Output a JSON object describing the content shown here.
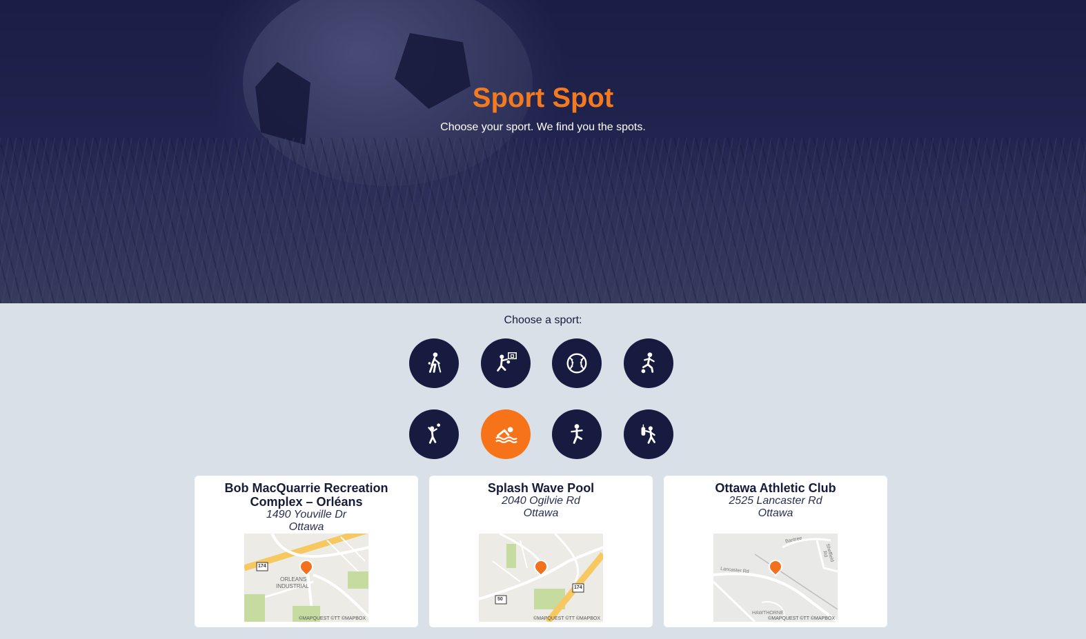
{
  "hero": {
    "title": "Sport Spot",
    "subtitle": "Choose your sport. We find you the spots."
  },
  "chooser": {
    "label": "Choose a sport:",
    "sports": [
      {
        "icon": "cricket-icon",
        "selected": false
      },
      {
        "icon": "basketball-icon",
        "selected": false
      },
      {
        "icon": "baseball-icon",
        "selected": false
      },
      {
        "icon": "soccer-icon",
        "selected": false
      },
      {
        "icon": "volleyball-icon",
        "selected": false
      },
      {
        "icon": "swimming-icon",
        "selected": true
      },
      {
        "icon": "gymnastics-icon",
        "selected": false
      },
      {
        "icon": "boxing-icon",
        "selected": false
      }
    ]
  },
  "colors": {
    "accent": "#f37a1f",
    "navy": "#181b40",
    "page_bg": "#d9e0e8"
  },
  "results": [
    {
      "name": "Bob MacQuarrie Recreation Complex – Orléans",
      "street": "1490 Youville Dr",
      "city": "Ottawa",
      "map": {
        "road_badge": "174",
        "area_label_1": "ORLEANS",
        "area_label_2": "INDUSTRIAL",
        "credit": "©MAPQUEST ©TT ©MAPBOX"
      }
    },
    {
      "name": "Splash Wave Pool",
      "street": "2040 Ogilvie Rd",
      "city": "Ottawa",
      "map": {
        "road_badge": "174",
        "road_badge_2": "50",
        "credit": "©MAPQUEST ©TT ©MAPBOX"
      }
    },
    {
      "name": "Ottawa Athletic Club",
      "street": "2525 Lancaster Rd",
      "city": "Ottawa",
      "map": {
        "street_label_1": "Lancaster Rd",
        "street_label_2": "Bantree",
        "street_label_3": "Sheffield Rd",
        "area_label": "HAWTHORNE",
        "credit": "©MAPQUEST ©TT ©MAPBOX"
      }
    }
  ]
}
